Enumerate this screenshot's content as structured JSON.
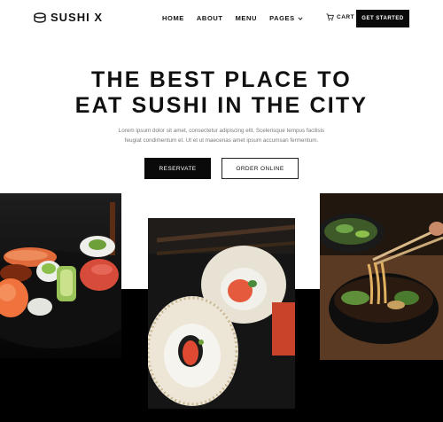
{
  "brand": {
    "name": "SUSHI X",
    "icon": "sushi-logo-icon"
  },
  "nav": {
    "items": [
      {
        "label": "HOME"
      },
      {
        "label": "ABOUT"
      },
      {
        "label": "MENU"
      },
      {
        "label": "PAGES",
        "icon": "chevron-down-icon"
      }
    ],
    "cart_label": "CART",
    "cart_icon": "cart-icon",
    "cta_label": "GET STARTED"
  },
  "hero": {
    "title_line1": "THE BEST PLACE TO",
    "title_line2": "EAT SUSHI IN THE CITY",
    "subtitle_line1": "Lorem ipsum dolor sit amet, consectetur adipiscing elit. Scelerisque tempus facilisis",
    "subtitle_line2": "feugiat condimentum et. Ut et ut maecenas amet ipsum accumsan fermentum.",
    "primary_button": "RESERVATE",
    "secondary_button": "ORDER ONLINE"
  },
  "colors": {
    "accent": "#0a0a0a",
    "background": "#ffffff",
    "muted_text": "#7a7a7a"
  }
}
